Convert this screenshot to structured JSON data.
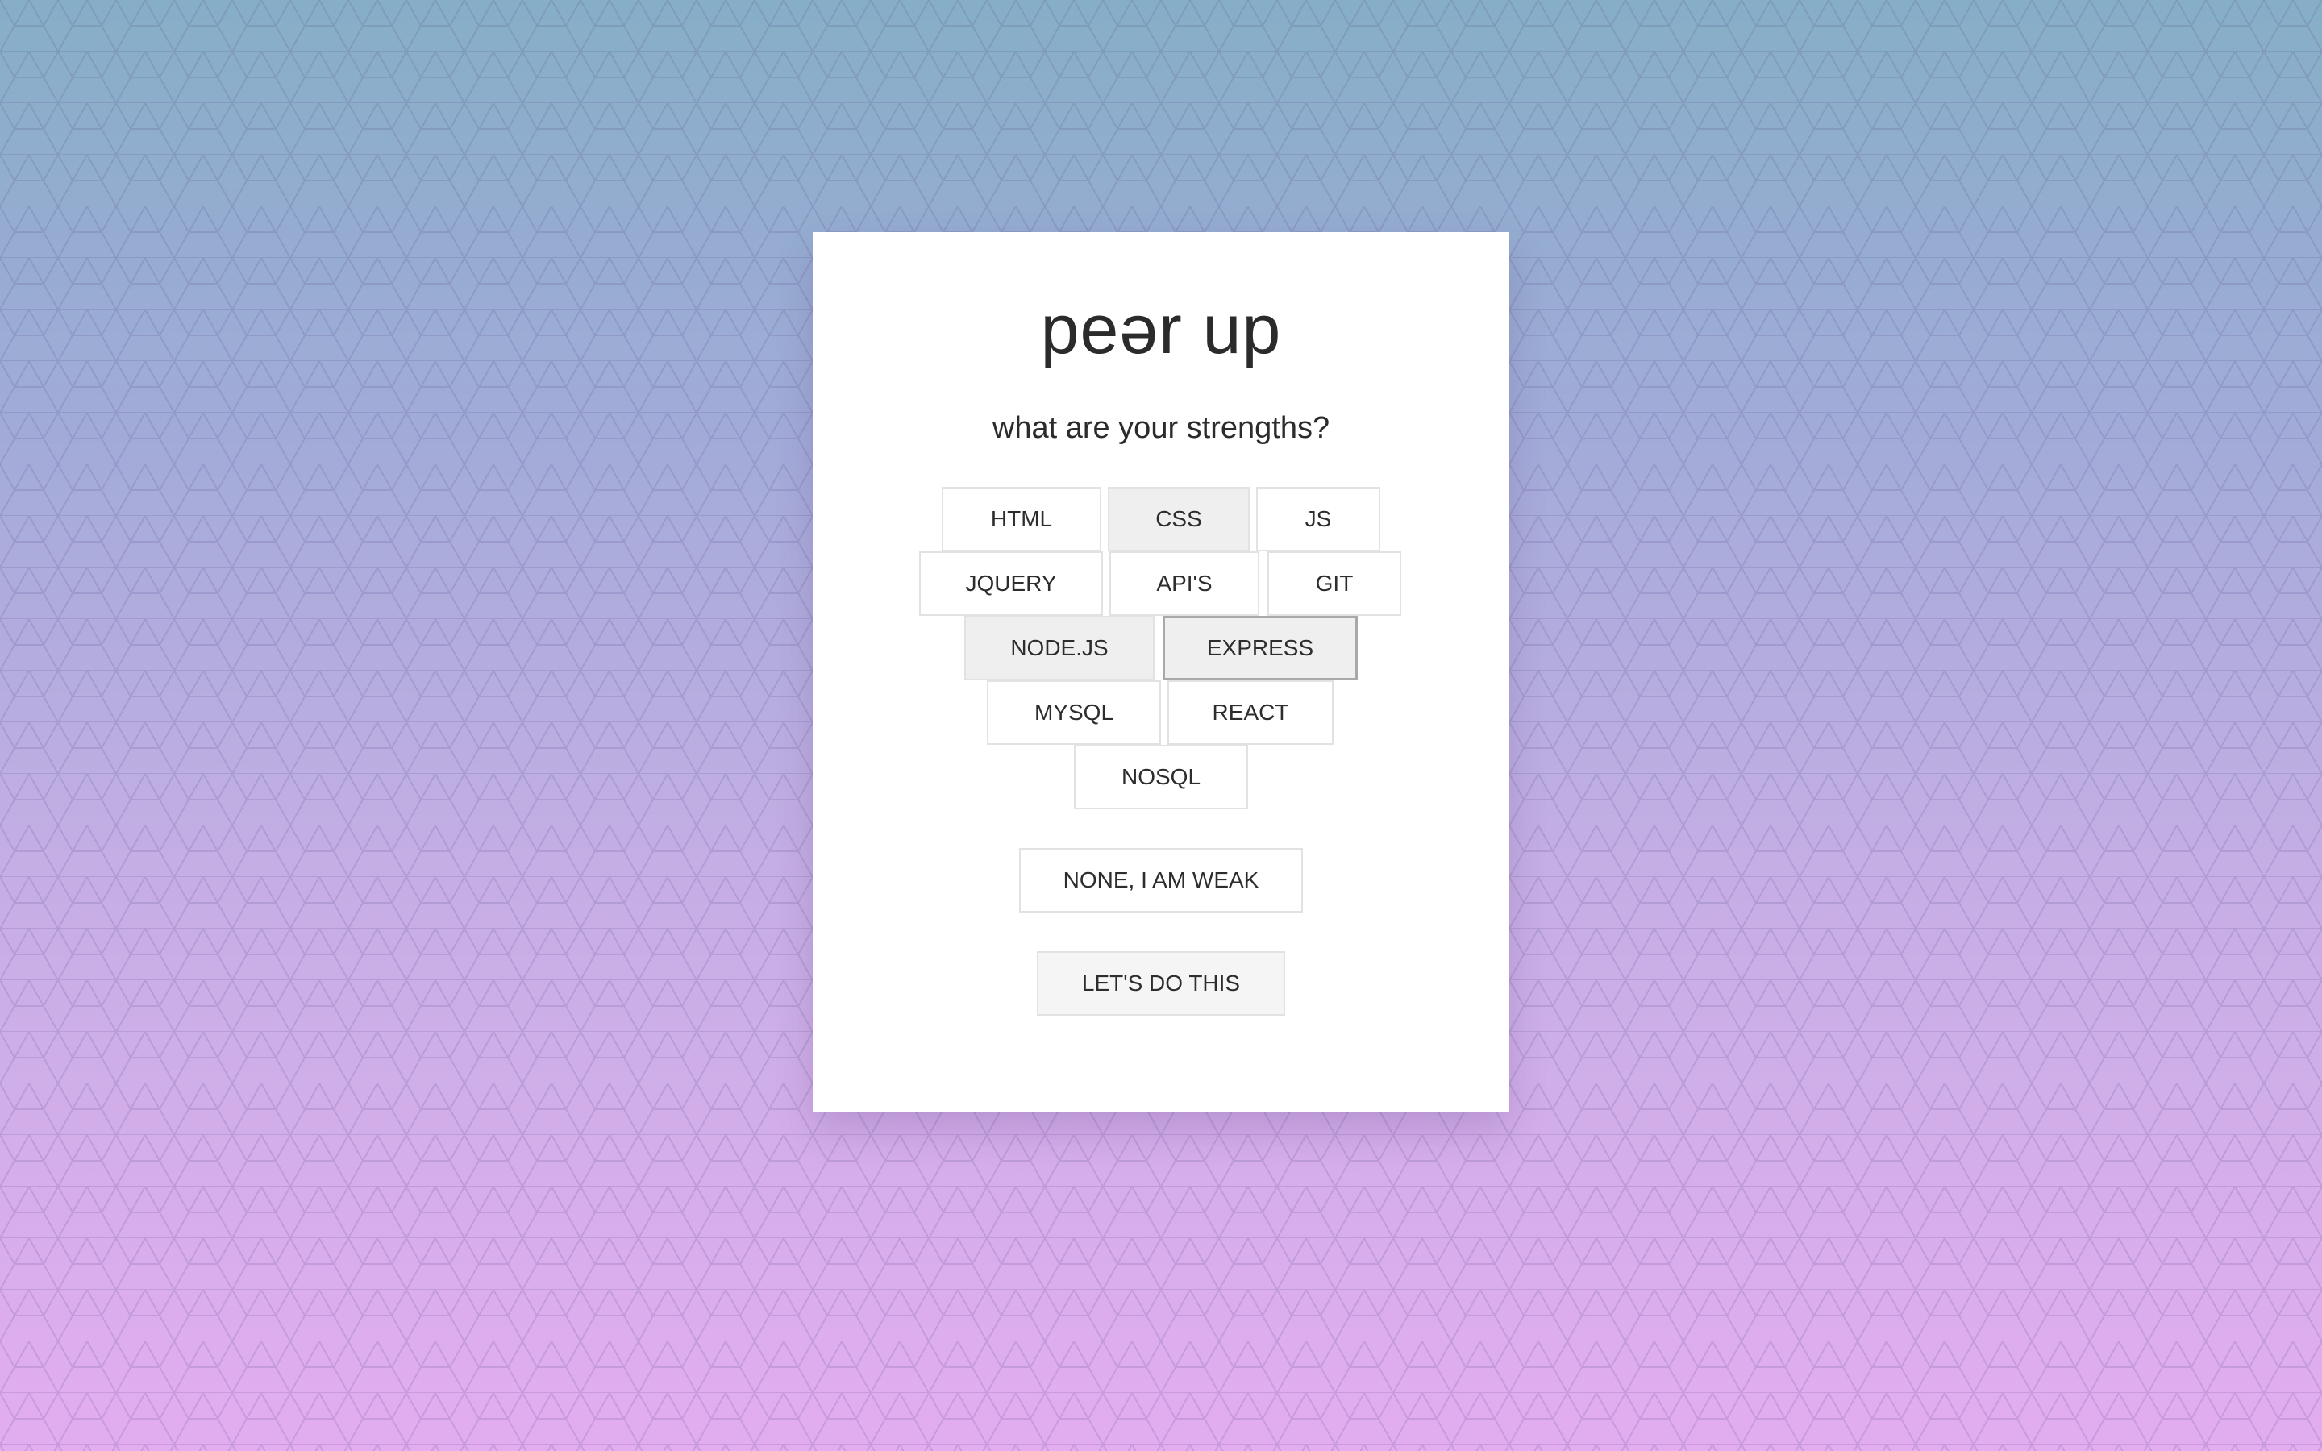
{
  "app": {
    "logo": "peər up",
    "question": "what are your strengths?"
  },
  "skills": [
    {
      "label": "HTML",
      "state": "default"
    },
    {
      "label": "CSS",
      "state": "selected"
    },
    {
      "label": "JS",
      "state": "default"
    },
    {
      "label": "JQUERY",
      "state": "default"
    },
    {
      "label": "API'S",
      "state": "default"
    },
    {
      "label": "GIT",
      "state": "default"
    },
    {
      "label": "NODE.JS",
      "state": "selected"
    },
    {
      "label": "EXPRESS",
      "state": "selected-focused"
    },
    {
      "label": "MYSQL",
      "state": "default"
    },
    {
      "label": "REACT",
      "state": "default"
    },
    {
      "label": "NOSQL",
      "state": "default"
    }
  ],
  "actions": {
    "none_label": "NONE, I AM WEAK",
    "submit_label": "LET'S DO THIS"
  },
  "colors": {
    "background_top": "#86aec7",
    "background_bottom": "#e3adef",
    "card": "#ffffff",
    "text": "#2b2b2b",
    "chip_border": "#e2e2e2",
    "chip_selected": "#efefef"
  }
}
